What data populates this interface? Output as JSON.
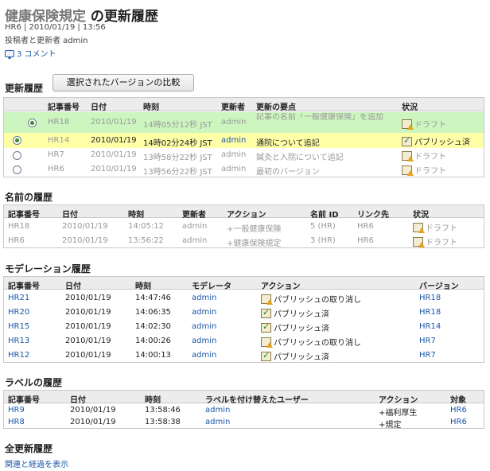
{
  "header": {
    "title_part1": "健康保険規定",
    "title_part2": " の更新履歴",
    "meta_line": "HR6 | 2010/01/19 | 13:56",
    "author_line": "投稿者と更新者 admin",
    "comments_link": "3 コメント"
  },
  "update_history": {
    "title": "更新履歴",
    "compare_button": "選択されたバージョンの比較",
    "columns": [
      "記事番号",
      "日付",
      "時刻",
      "更新者",
      "更新の要点",
      "状況"
    ],
    "rows": [
      {
        "id": "HR18",
        "date": "2010/01/19",
        "time": "14時05分12秒 JST",
        "updater": "admin",
        "summary": "記事の名前「一般健康保険」を追加",
        "status": "ドラフト",
        "status_icon": "draft-icon"
      },
      {
        "id": "HR14",
        "date": "2010/01/19",
        "time": "14時02分24秒 JST",
        "updater": "admin",
        "summary": "通院について追記",
        "status": "パブリッシュ済",
        "status_icon": "published-icon"
      },
      {
        "id": "HR7",
        "date": "2010/01/19",
        "time": "13時58分22秒 JST",
        "updater": "admin",
        "summary": "鍼灸と入院について追記",
        "status": "ドラフト",
        "status_icon": "draft-icon"
      },
      {
        "id": "HR6",
        "date": "2010/01/19",
        "time": "13時56分22秒 JST",
        "updater": "admin",
        "summary": "最初のバージョン",
        "status": "ドラフト",
        "status_icon": "draft-icon"
      }
    ],
    "row_colors": {
      "compare_selected": "#cdf5c0",
      "current": "#ffffa8"
    }
  },
  "name_history": {
    "title": "名前の履歴",
    "columns": [
      "記事番号",
      "日付",
      "時刻",
      "更新者",
      "アクション",
      "名前 ID",
      "リンク先",
      "状況"
    ],
    "rows": [
      {
        "id": "HR18",
        "date": "2010/01/19",
        "time": "14:05:12",
        "updater": "admin",
        "action": "+一般健康保険",
        "name_id": "5 (HR)",
        "link": "HR6",
        "status": "ドラフト"
      },
      {
        "id": "HR6",
        "date": "2010/01/19",
        "time": "13:56:22",
        "updater": "admin",
        "action": "+健康保険規定",
        "name_id": "3 (HR)",
        "link": "HR6",
        "status": "ドラフト"
      }
    ]
  },
  "moderation_history": {
    "title": "モデレーション履歴",
    "columns": [
      "記事番号",
      "日付",
      "時刻",
      "モデレータ",
      "アクション",
      "バージョン"
    ],
    "rows": [
      {
        "id": "HR21",
        "date": "2010/01/19",
        "time": "14:47:46",
        "moderator": "admin",
        "action": "パブリッシュの取り消し",
        "action_icon": "draft-icon",
        "version": "HR18"
      },
      {
        "id": "HR20",
        "date": "2010/01/19",
        "time": "14:06:35",
        "moderator": "admin",
        "action": "パブリッシュ済",
        "action_icon": "published-icon",
        "version": "HR18"
      },
      {
        "id": "HR15",
        "date": "2010/01/19",
        "time": "14:02:30",
        "moderator": "admin",
        "action": "パブリッシュ済",
        "action_icon": "published-icon",
        "version": "HR14"
      },
      {
        "id": "HR13",
        "date": "2010/01/19",
        "time": "14:00:26",
        "moderator": "admin",
        "action": "パブリッシュの取り消し",
        "action_icon": "draft-icon",
        "version": "HR7"
      },
      {
        "id": "HR12",
        "date": "2010/01/19",
        "time": "14:00:13",
        "moderator": "admin",
        "action": "パブリッシュ済",
        "action_icon": "published-icon",
        "version": "HR7"
      }
    ]
  },
  "label_history": {
    "title": "ラベルの履歴",
    "columns": [
      "記事番号",
      "日付",
      "時刻",
      "ラベルを付け替えたユーザー",
      "アクション",
      "対象"
    ],
    "rows": [
      {
        "id": "HR9",
        "date": "2010/01/19",
        "time": "13:58:46",
        "user": "admin",
        "action": "+福利厚生",
        "target": "HR6"
      },
      {
        "id": "HR8",
        "date": "2010/01/19",
        "time": "13:58:38",
        "user": "admin",
        "action": "+規定",
        "target": "HR6"
      }
    ]
  },
  "full_history": {
    "title": "全更新履歴",
    "link": "関連と経過を表示"
  }
}
